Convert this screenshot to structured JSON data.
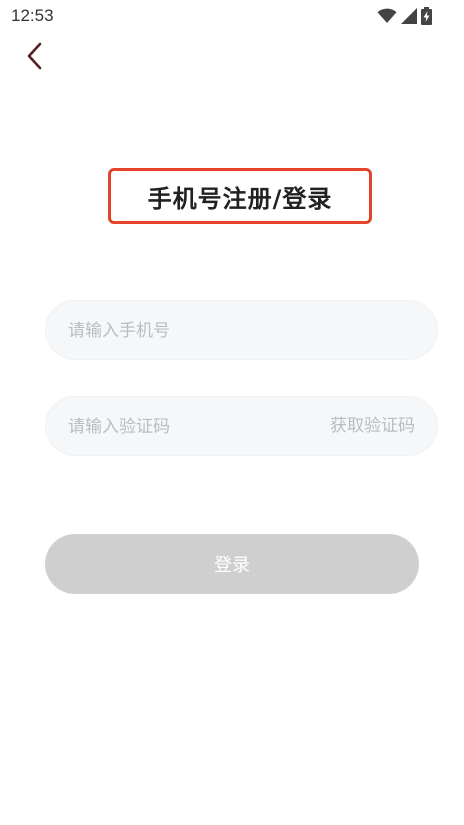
{
  "status_bar": {
    "time": "12:53",
    "icons": [
      "wifi-icon",
      "signal-icon",
      "battery-charging-icon"
    ]
  },
  "nav": {
    "back_icon": "chevron-left-icon",
    "back_color": "#5a1f1f"
  },
  "title": "手机号注册/登录",
  "form": {
    "phone_placeholder": "请输入手机号",
    "phone_value": "",
    "code_placeholder": "请输入验证码",
    "code_value": "",
    "get_code_label": "获取验证码"
  },
  "login_label": "登录",
  "colors": {
    "highlight_border": "#e5432a",
    "field_bg": "#f6f7f9",
    "button_disabled": "#cfcfcf"
  }
}
